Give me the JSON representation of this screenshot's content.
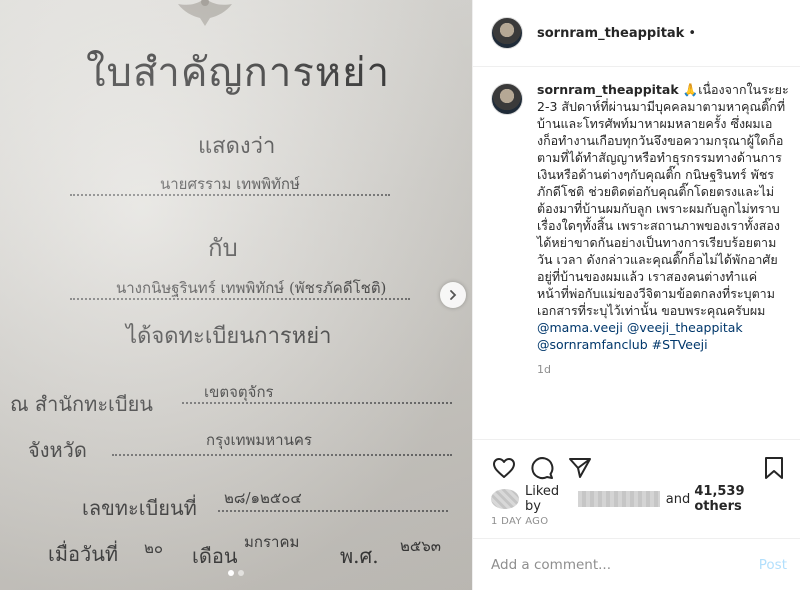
{
  "photo": {
    "document": {
      "title": "ใบสำคัญการหย่า",
      "shows": "แสดงว่า",
      "name1": "นายศรราม เทพพิทักษ์",
      "with": "กับ",
      "name2": "นางกนิษฐรินทร์ เทพพิทักษ์ (พัชรภัคดีโชติ)",
      "registered": "ได้จดทะเบียนการหย่า",
      "office_label": "ณ สำนักทะเบียน",
      "office_value": "เขตจตุจักร",
      "province_label": "จังหวัด",
      "province_value": "กรุงเทพมหานคร",
      "regno_label": "เลขทะเบียนที่",
      "regno_value": "๒๘/๑๒๕๐๔",
      "date_label": "เมื่อวันที่",
      "date_day": "๒๐",
      "month_label": "เดือน",
      "date_month": "มกราคม",
      "year_label": "พ.ศ.",
      "date_year": "๒๕๖๓"
    },
    "carousel": {
      "slides": 2,
      "active": 1
    },
    "next_icon": "chevron-right-icon"
  },
  "header": {
    "username": "sornram_theappitak",
    "separator": "•"
  },
  "caption": {
    "username": "sornram_theappitak",
    "text": "🙏เนื่องจากในระยะ 2-3 สัปดาห์ที่ผ่านมามีบุคคลมาตามหาคุณติ๊กที่บ้านและโทรศัพท์มาหาผมหลายครั้ง ซึ่งผมเองก็อทำงานเกือบทุกวันจึงขอความกรุณาผู้ใดก็อตามที่ได้ทำสัญญาหรือทำธุรกรรมทางด้านการเงินหรือด้านต่างๆกับคุณติ๊ก กนิษฐรินทร์ พัชรภักดีโชติ ช่วยติดต่อกับคุณติ๊กโดยตรงและไม่ต้องมาที่บ้านผมกับลูก เพราะผมกับลูกไม่ทราบเรื่องใดๆทั้งสิ้น เพราะสถานภาพของเราทั้งสองได้หย่าขาดกันอย่างเป็นทางการเรียบร้อยตามวัน เวลา ดังกล่าวและคุณติ๊กก็อไม่ได้พักอาศัยอยู่ที่บ้านของผมแล้ว เราสองคนต่างทำแค่หน้าที่พ่อกับแม่ของวีจิตามข้อตกลงที่ระบุตามเอกสารที่ระบุไว้เท่านั้น ขอบพระคุณครับผม ",
    "mentions": [
      "@mama.veeji",
      "@veeji_theappitak",
      "@sornramfanclub",
      "#STVeeji"
    ],
    "timestamp": "1d"
  },
  "actions": {
    "like_icon": "heart-icon",
    "comment_icon": "comment-icon",
    "share_icon": "share-icon",
    "save_icon": "bookmark-icon",
    "liked_by_label": "Liked by",
    "and_label": "and",
    "like_count": "41,539 others",
    "post_age": "1 DAY AGO"
  },
  "comment": {
    "placeholder": "Add a comment...",
    "post_label": "Post"
  },
  "colors": {
    "link": "#00376b",
    "post_disabled": "#b2dffc",
    "muted": "#8e8e8e"
  }
}
